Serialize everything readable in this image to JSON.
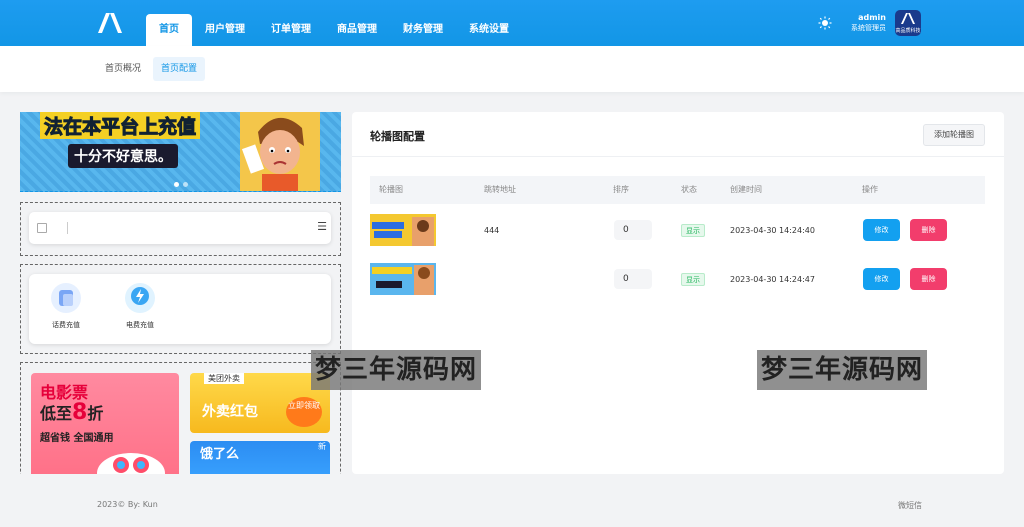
{
  "header": {
    "nav": [
      "首页",
      "用户管理",
      "订单管理",
      "商品管理",
      "财务管理",
      "系统设置"
    ],
    "active_nav": "首页",
    "user_name": "admin",
    "user_role": "系统管理员",
    "avatar_text": "高品质科技",
    "brand_color": "#1296e6"
  },
  "subtabs": [
    "首页概况",
    "首页配置"
  ],
  "active_subtab": "首页配置",
  "preview": {
    "banner_text_1": "法在本平台上充值",
    "banner_text_2": "十分不好意思。",
    "menu_icon": "☰",
    "icons": [
      {
        "label": "话费充值",
        "icon": "phone-recharge-icon"
      },
      {
        "label": "电费充值",
        "icon": "electric-recharge-icon"
      }
    ],
    "ad_movie": {
      "line1": "电影票",
      "line2_prefix": "低至",
      "line2_big": "8",
      "line2_suffix": "折",
      "line3": "超省钱 全国通用"
    },
    "ad_takeout": {
      "brand": "美团外卖",
      "big": "外卖红包",
      "badge": "立即领取"
    },
    "ad_eleme": {
      "logo": "饿了么",
      "tag": "新"
    }
  },
  "carousel": {
    "title": "轮播图配置",
    "add_label": "添加轮播图",
    "columns": [
      "轮播图",
      "跳转地址",
      "排序",
      "状态",
      "创建时间",
      "操作"
    ],
    "rows": [
      {
        "url": "444",
        "sort": "0",
        "status": "显示",
        "created": "2023-04-30 14:24:40",
        "edit": "修改",
        "delete": "删除"
      },
      {
        "url": "",
        "sort": "0",
        "status": "显示",
        "created": "2023-04-30 14:24:47",
        "edit": "修改",
        "delete": "删除"
      }
    ]
  },
  "watermark": "梦三年源码网",
  "footer": {
    "left": "2023© By: Kun",
    "right": "微短信"
  }
}
